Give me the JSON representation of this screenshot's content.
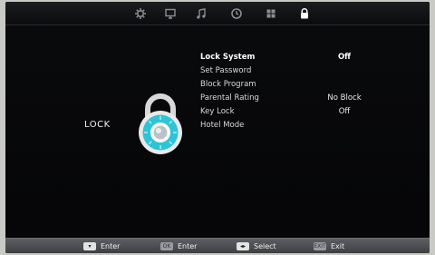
{
  "top_tabs": [
    {
      "icon": "gear-icon",
      "active": false
    },
    {
      "icon": "monitor-icon",
      "active": false
    },
    {
      "icon": "music-note-icon",
      "active": false
    },
    {
      "icon": "clock-icon",
      "active": false
    },
    {
      "icon": "grid-icon",
      "active": false
    },
    {
      "icon": "lock-icon",
      "active": true
    }
  ],
  "section": {
    "label": "LOCK"
  },
  "menu": {
    "items": [
      {
        "label": "Lock System",
        "value": "Off",
        "selected": true
      },
      {
        "label": "Set Password",
        "value": ""
      },
      {
        "label": "Block Program",
        "value": ""
      },
      {
        "label": "Parental Rating",
        "value": "No Block"
      },
      {
        "label": "Key Lock",
        "value": "Off"
      },
      {
        "label": "Hotel Mode",
        "value": ""
      }
    ]
  },
  "footer": {
    "hints": [
      {
        "key": "▾",
        "label": "Enter"
      },
      {
        "key": "OK",
        "label": "Enter"
      },
      {
        "key": "◂▸",
        "label": "Select"
      },
      {
        "key": "EXIT",
        "label": "Exit"
      }
    ]
  },
  "colors": {
    "lock_accent": "#2ec4d6",
    "lock_ring": "#d9d9d9",
    "background": "#050507"
  }
}
